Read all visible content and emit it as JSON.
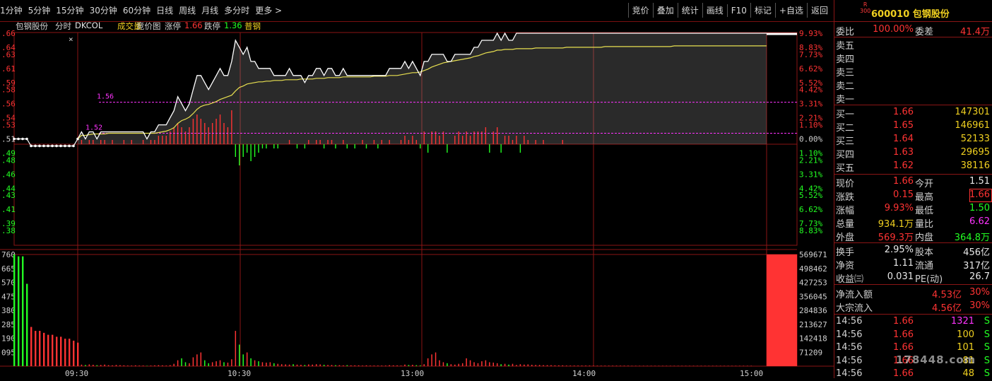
{
  "toolbar": {
    "periods": [
      "1分钟",
      "5分钟",
      "15分钟",
      "30分钟",
      "60分钟",
      "日线",
      "周线",
      "月线",
      "多分时",
      "更多 >"
    ],
    "tools": [
      "竞价",
      "叠加",
      "统计",
      "画线",
      "F10",
      "标记",
      "+自选",
      "返回"
    ]
  },
  "chart_header": {
    "name": "包钢股份",
    "view": "分时",
    "indicator": "DKCOL",
    "vol_label": "成交量",
    "auction": "竞价图",
    "limit_up_label": "涨停",
    "limit_up": "1.66",
    "limit_down_label": "跌停",
    "limit_down": "1.36",
    "tag": "普钢"
  },
  "colors": {
    "up": "#ff3333",
    "down": "#22ff22",
    "price_line": "#ffffff",
    "avg_line": "#e8e050",
    "grid": "#8a1515",
    "mark": "#ff33ff",
    "panel_bg": "#000000"
  },
  "chart_data": {
    "type": "line",
    "prev_close": 1.51,
    "price_axis": {
      "ticks": [
        1.66,
        1.64,
        1.63,
        1.61,
        1.59,
        1.58,
        1.56,
        1.54,
        1.53,
        1.51,
        1.49,
        1.48,
        1.46,
        1.44,
        1.43,
        1.41,
        1.39,
        1.38
      ],
      "labels": [
        ".66",
        ".64",
        ".63",
        ".61",
        ".59",
        ".58",
        ".56",
        ".54",
        ".53",
        ".51",
        ".49",
        ".48",
        ".46",
        ".44",
        ".43",
        ".41",
        ".39",
        ".38"
      ]
    },
    "pct_axis": {
      "values": [
        9.93,
        8.83,
        7.73,
        6.62,
        5.52,
        4.42,
        3.31,
        2.21,
        1.1,
        0.0,
        -1.1,
        -2.21,
        -3.31,
        -4.42,
        -5.52,
        -6.62,
        -7.73,
        -8.83
      ],
      "labels": [
        "9.93%",
        "8.83%",
        "7.73%",
        "6.62%",
        "5.52%",
        "4.42%",
        "3.31%",
        "2.21%",
        "1.10%",
        "0.00%",
        "1.10%",
        "2.21%",
        "3.31%",
        "4.42%",
        "5.52%",
        "6.62%",
        "7.73%",
        "8.83%"
      ]
    },
    "vol_axis": {
      "left": [
        "760",
        "665",
        "570",
        "475",
        "380",
        "285",
        "190",
        "095"
      ],
      "right": [
        "569671",
        "498462",
        "427253",
        "356045",
        "284836",
        "213627",
        "142418",
        "71209"
      ],
      "max": 569671
    },
    "time_labels": [
      "09:30",
      "10:30",
      "13:00",
      "14:00",
      "15:00"
    ],
    "auction_price": [
      1.51,
      1.51,
      1.51,
      1.51,
      1.5,
      1.5,
      1.5,
      1.5,
      1.5,
      1.5,
      1.5,
      1.5,
      1.5,
      1.5,
      1.5,
      1.51
    ],
    "price": [
      1.51,
      1.52,
      1.51,
      1.52,
      1.52,
      1.51,
      1.52,
      1.52,
      1.52,
      1.52,
      1.52,
      1.52,
      1.52,
      1.52,
      1.52,
      1.52,
      1.52,
      1.52,
      1.51,
      1.52,
      1.52,
      1.53,
      1.53,
      1.53,
      1.54,
      1.55,
      1.57,
      1.56,
      1.55,
      1.56,
      1.58,
      1.6,
      1.6,
      1.59,
      1.58,
      1.59,
      1.6,
      1.61,
      1.6,
      1.6,
      1.62,
      1.65,
      1.64,
      1.63,
      1.64,
      1.62,
      1.62,
      1.61,
      1.61,
      1.61,
      1.61,
      1.6,
      1.6,
      1.6,
      1.6,
      1.61,
      1.6,
      1.6,
      1.6,
      1.59,
      1.6,
      1.6,
      1.61,
      1.61,
      1.6,
      1.61,
      1.61,
      1.6,
      1.6,
      1.61,
      1.6,
      1.6,
      1.6,
      1.6,
      1.6,
      1.6,
      1.6,
      1.6,
      1.6,
      1.6,
      1.6,
      1.61,
      1.61,
      1.61,
      1.61,
      1.62,
      1.61,
      1.62,
      1.61,
      1.6,
      1.62,
      1.62,
      1.63,
      1.63,
      1.63,
      1.63,
      1.62,
      1.62,
      1.63,
      1.63,
      1.63,
      1.63,
      1.63,
      1.64,
      1.64,
      1.65,
      1.65,
      1.65,
      1.65,
      1.66,
      1.65,
      1.66,
      1.65,
      1.65,
      1.66,
      1.66,
      1.66,
      1.66,
      1.66,
      1.66,
      1.66,
      1.66,
      1.66,
      1.66,
      1.66,
      1.66,
      1.66,
      1.66,
      1.66,
      1.66,
      1.66,
      1.66,
      1.66,
      1.66,
      1.66,
      1.66,
      1.66,
      1.66,
      1.66,
      1.66,
      1.66,
      1.66,
      1.66,
      1.66,
      1.66,
      1.66,
      1.66,
      1.66,
      1.66,
      1.66,
      1.66,
      1.66,
      1.66,
      1.66,
      1.66,
      1.66,
      1.66,
      1.66,
      1.66,
      1.66,
      1.66,
      1.66,
      1.66,
      1.66,
      1.66,
      1.66,
      1.66,
      1.66,
      1.66,
      1.66,
      1.66,
      1.66,
      1.66,
      1.66,
      1.66,
      1.66,
      1.66,
      1.66,
      1.66,
      1.66
    ],
    "avg_price": [
      1.51,
      1.515,
      1.515,
      1.516,
      1.517,
      1.517,
      1.517,
      1.517,
      1.518,
      1.518,
      1.518,
      1.518,
      1.518,
      1.518,
      1.518,
      1.518,
      1.518,
      1.518,
      1.518,
      1.518,
      1.518,
      1.519,
      1.52,
      1.521,
      1.523,
      1.526,
      1.532,
      1.536,
      1.538,
      1.541,
      1.546,
      1.552,
      1.556,
      1.558,
      1.559,
      1.561,
      1.563,
      1.566,
      1.568,
      1.57,
      1.572,
      1.578,
      1.583,
      1.585,
      1.588,
      1.589,
      1.59,
      1.591,
      1.591,
      1.592,
      1.592,
      1.593,
      1.593,
      1.593,
      1.594,
      1.594,
      1.594,
      1.594,
      1.595,
      1.595,
      1.595,
      1.595,
      1.596,
      1.596,
      1.596,
      1.597,
      1.597,
      1.597,
      1.597,
      1.598,
      1.598,
      1.598,
      1.598,
      1.598,
      1.598,
      1.598,
      1.598,
      1.599,
      1.599,
      1.599,
      1.599,
      1.6,
      1.6,
      1.6,
      1.601,
      1.602,
      1.603,
      1.604,
      1.604,
      1.605,
      1.607,
      1.609,
      1.612,
      1.614,
      1.616,
      1.618,
      1.619,
      1.62,
      1.621,
      1.622,
      1.623,
      1.624,
      1.625,
      1.627,
      1.628,
      1.63,
      1.632,
      1.633,
      1.634,
      1.636,
      1.636,
      1.637,
      1.637,
      1.637,
      1.638,
      1.638,
      1.638,
      1.638,
      1.638,
      1.639,
      1.639,
      1.639,
      1.639,
      1.639,
      1.639,
      1.639,
      1.639,
      1.64,
      1.64,
      1.64,
      1.64,
      1.64,
      1.64,
      1.64,
      1.64,
      1.64,
      1.64,
      1.641,
      1.641,
      1.641,
      1.641,
      1.641,
      1.641,
      1.641,
      1.641,
      1.641,
      1.641,
      1.641,
      1.641,
      1.641,
      1.641,
      1.641,
      1.641,
      1.641,
      1.641,
      1.642,
      1.642,
      1.642,
      1.642,
      1.642,
      1.642,
      1.642,
      1.642,
      1.642,
      1.642,
      1.642,
      1.642,
      1.642,
      1.642,
      1.642,
      1.642,
      1.642,
      1.642,
      1.642,
      1.642,
      1.642,
      1.642,
      1.642,
      1.642,
      1.642
    ],
    "auction_volume": [
      569671,
      560000,
      560000,
      420000,
      200000,
      180000,
      180000,
      170000,
      160000,
      160000,
      150000,
      150000,
      140000,
      140000,
      130000,
      120000
    ],
    "volume": [
      12000,
      8000,
      6000,
      9000,
      7000,
      5000,
      6000,
      8000,
      5000,
      4000,
      6000,
      5000,
      4000,
      3000,
      3000,
      4000,
      3000,
      3000,
      2000,
      3000,
      4000,
      5000,
      4000,
      3000,
      5000,
      12000,
      30000,
      40000,
      20000,
      15000,
      45000,
      60000,
      70000,
      30000,
      15000,
      20000,
      25000,
      30000,
      20000,
      18000,
      35000,
      180000,
      110000,
      60000,
      70000,
      40000,
      30000,
      25000,
      20000,
      18000,
      20000,
      15000,
      12000,
      10000,
      9000,
      8000,
      10000,
      8000,
      7000,
      6000,
      9000,
      8000,
      10000,
      9000,
      7000,
      6000,
      6000,
      5000,
      5000,
      4000,
      5000,
      4000,
      4000,
      4000,
      3000,
      4000,
      3000,
      3000,
      3000,
      3000,
      3000,
      5000,
      4000,
      4000,
      3000,
      8000,
      6000,
      7000,
      5000,
      4000,
      10000,
      40000,
      60000,
      70000,
      30000,
      20000,
      15000,
      10000,
      8000,
      12000,
      15000,
      40000,
      30000,
      20000,
      15000,
      25000,
      30000,
      20000,
      18000,
      15000,
      10000,
      12000,
      8000,
      12000,
      6000,
      10000,
      8000,
      9000,
      7000,
      6000,
      6000,
      5000,
      5000,
      5000,
      4000,
      4000,
      4000,
      3000,
      3000,
      3000,
      3000,
      3000,
      3000,
      3000,
      2500,
      2500,
      2500,
      2500,
      2500,
      2500,
      2500,
      2500,
      2500,
      2500,
      2000,
      2000,
      2000,
      2000,
      2000,
      2000,
      2000,
      2000,
      2000,
      2000,
      2000,
      2000,
      2000,
      2000,
      2000,
      2000,
      2000,
      2000,
      2000,
      2000,
      2000,
      2000,
      2000,
      2000,
      2000,
      2000,
      2000,
      2000,
      2000,
      2000,
      2000,
      2000
    ],
    "flow": [
      0,
      1,
      0,
      1,
      1,
      0,
      1,
      1,
      0,
      1,
      0,
      0,
      1,
      0,
      1,
      0,
      0,
      1,
      0,
      1,
      1,
      2,
      2,
      2,
      3,
      4,
      5,
      4,
      3,
      4,
      6,
      7,
      6,
      5,
      4,
      5,
      6,
      7,
      5,
      4,
      8,
      -3,
      -5,
      -3,
      -2,
      -4,
      -3,
      -2,
      -1,
      -1,
      0,
      -1,
      -1,
      0,
      0,
      1,
      0,
      -1,
      0,
      -1,
      1,
      0,
      1,
      1,
      -1,
      1,
      1,
      -1,
      0,
      1,
      -1,
      0,
      -1,
      0,
      1,
      -1,
      0,
      1,
      -1,
      1,
      0,
      1,
      0,
      0,
      1,
      2,
      1,
      2,
      1,
      -1,
      3,
      -2,
      3,
      3,
      2,
      3,
      -2,
      0,
      2,
      3,
      2,
      3,
      2,
      3,
      3,
      3,
      4,
      -2,
      3,
      4,
      -2,
      2,
      2,
      1,
      2,
      -2,
      2,
      1,
      0,
      1,
      0,
      1,
      0,
      0,
      0,
      0,
      1,
      0,
      0,
      0,
      0,
      0,
      0,
      0,
      0,
      0,
      0,
      0,
      0,
      0,
      0,
      0,
      0,
      0,
      0,
      0,
      0,
      0,
      0,
      0,
      0,
      0,
      0,
      0,
      0,
      0,
      0,
      0,
      0,
      0,
      0,
      0,
      0,
      0,
      0,
      0,
      0,
      0,
      0,
      0,
      0,
      0,
      0,
      0,
      0,
      0,
      0,
      0,
      0,
      0
    ],
    "marks": [
      {
        "label": "1.56",
        "price": 1.562
      },
      {
        "label": "1.52",
        "price": 1.518
      }
    ]
  },
  "quote": {
    "badge_top": "R",
    "badge_bot": "300",
    "code": "600010",
    "name": "包钢股份",
    "weibi_label": "委比",
    "weibi": "100.00%",
    "weicha_label": "委差",
    "weicha": "41.4万",
    "asks": [
      {
        "label": "卖五"
      },
      {
        "label": "卖四"
      },
      {
        "label": "卖三"
      },
      {
        "label": "卖二"
      },
      {
        "label": "卖一"
      }
    ],
    "bids": [
      {
        "label": "买一",
        "price": "1.66",
        "vol": "147301"
      },
      {
        "label": "买二",
        "price": "1.65",
        "vol": "146961"
      },
      {
        "label": "买三",
        "price": "1.64",
        "vol": "52133"
      },
      {
        "label": "买四",
        "price": "1.63",
        "vol": "29695"
      },
      {
        "label": "买五",
        "price": "1.62",
        "vol": "38116"
      }
    ],
    "stats": [
      {
        "l1": "现价",
        "v1": "1.66",
        "l2": "今开",
        "v2": "1.51",
        "c1": "red",
        "c2": "wht"
      },
      {
        "l1": "涨跌",
        "v1": "0.15",
        "l2": "最高",
        "v2": "1.66",
        "c1": "red",
        "c2": "red"
      },
      {
        "l1": "涨幅",
        "v1": "9.93%",
        "l2": "最低",
        "v2": "1.50",
        "c1": "red",
        "c2": "green"
      },
      {
        "l1": "总量",
        "v1": "934.1万",
        "l2": "量比",
        "v2": "6.62",
        "c1": "yel",
        "c2": "mag"
      },
      {
        "l1": "外盘",
        "v1": "569.3万",
        "l2": "内盘",
        "v2": "364.8万",
        "c1": "red",
        "c2": "green"
      }
    ],
    "stats2": [
      {
        "l1": "换手",
        "v1": "2.95%",
        "l2": "股本",
        "v2": "456亿"
      },
      {
        "l1": "净资",
        "v1": "1.11",
        "l2": "流通",
        "v2": "317亿"
      },
      {
        "l1": "收益㈢",
        "v1": "0.031",
        "l2": "PE(动)",
        "v2": "26.7"
      }
    ],
    "flows": [
      {
        "l": "净流入额",
        "v": "4.53亿",
        "p": "30%"
      },
      {
        "l": "大宗流入",
        "v": "4.56亿",
        "p": "30%"
      }
    ],
    "ticks": [
      {
        "time": "14:56",
        "price": "1.66",
        "vol": "1321",
        "side": "S",
        "vc": "mag"
      },
      {
        "time": "14:56",
        "price": "1.66",
        "vol": "100",
        "side": "S",
        "vc": "yel"
      },
      {
        "time": "14:56",
        "price": "1.66",
        "vol": "101",
        "side": "S",
        "vc": "yel"
      },
      {
        "time": "14:56",
        "price": "1.66",
        "vol": "81",
        "side": "S",
        "vc": "yel"
      },
      {
        "time": "14:56",
        "price": "1.66",
        "vol": "48",
        "side": "S",
        "vc": "yel"
      }
    ]
  },
  "watermark": "178448.com"
}
